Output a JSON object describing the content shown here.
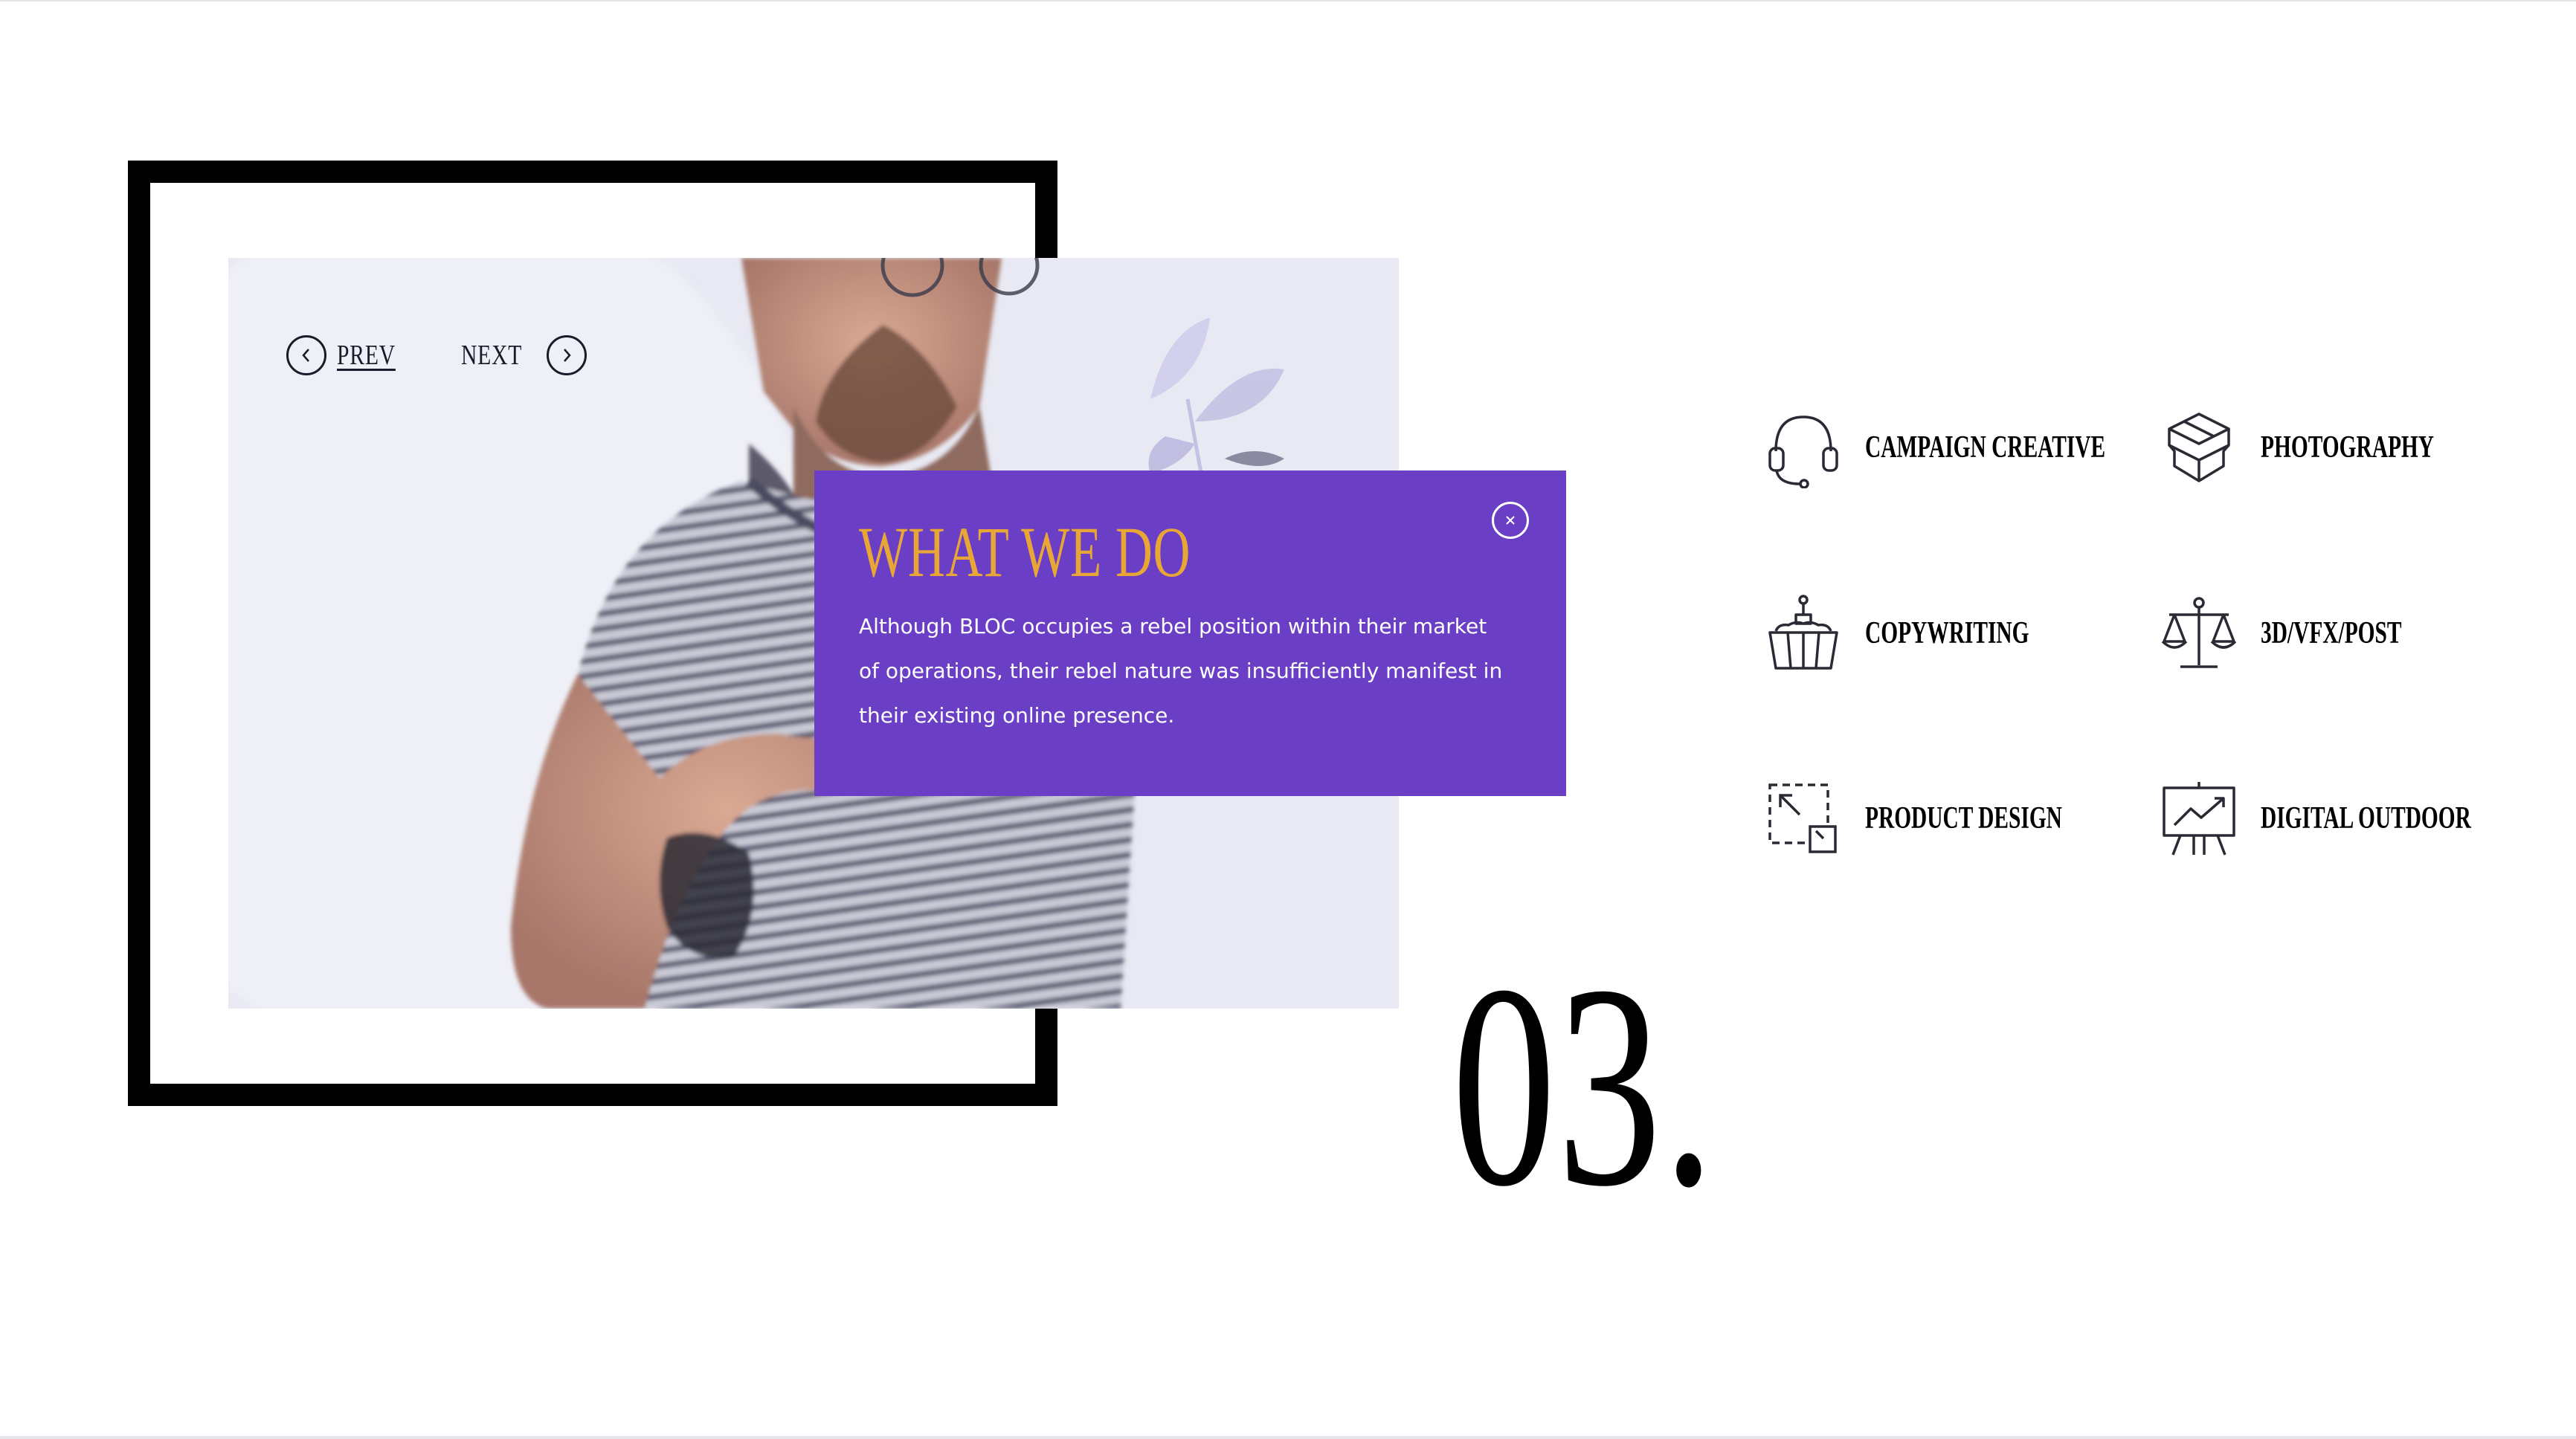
{
  "slider": {
    "prev_label": "PREV",
    "next_label": "NEXT"
  },
  "card": {
    "title": "WHAT WE DO",
    "body": "Although BLOC occupies a rebel position within their market of operations, their rebel nature was insufficiently manifest in their existing online presence."
  },
  "section_number": "03.",
  "services": [
    {
      "label": "CAMPAIGN CREATIVE",
      "icon": "headset-icon"
    },
    {
      "label": "PHOTOGRAPHY",
      "icon": "box-icon"
    },
    {
      "label": "COPYWRITING",
      "icon": "cake-icon"
    },
    {
      "label": "3D/VFX/POST",
      "icon": "scales-icon"
    },
    {
      "label": "PRODUCT DESIGN",
      "icon": "resize-icon"
    },
    {
      "label": "DIGITAL OUTDOOR",
      "icon": "presentation-chart-icon"
    }
  ],
  "colors": {
    "card_background": "#6a3fc6",
    "card_title": "#e8a636",
    "frame": "#000000"
  }
}
